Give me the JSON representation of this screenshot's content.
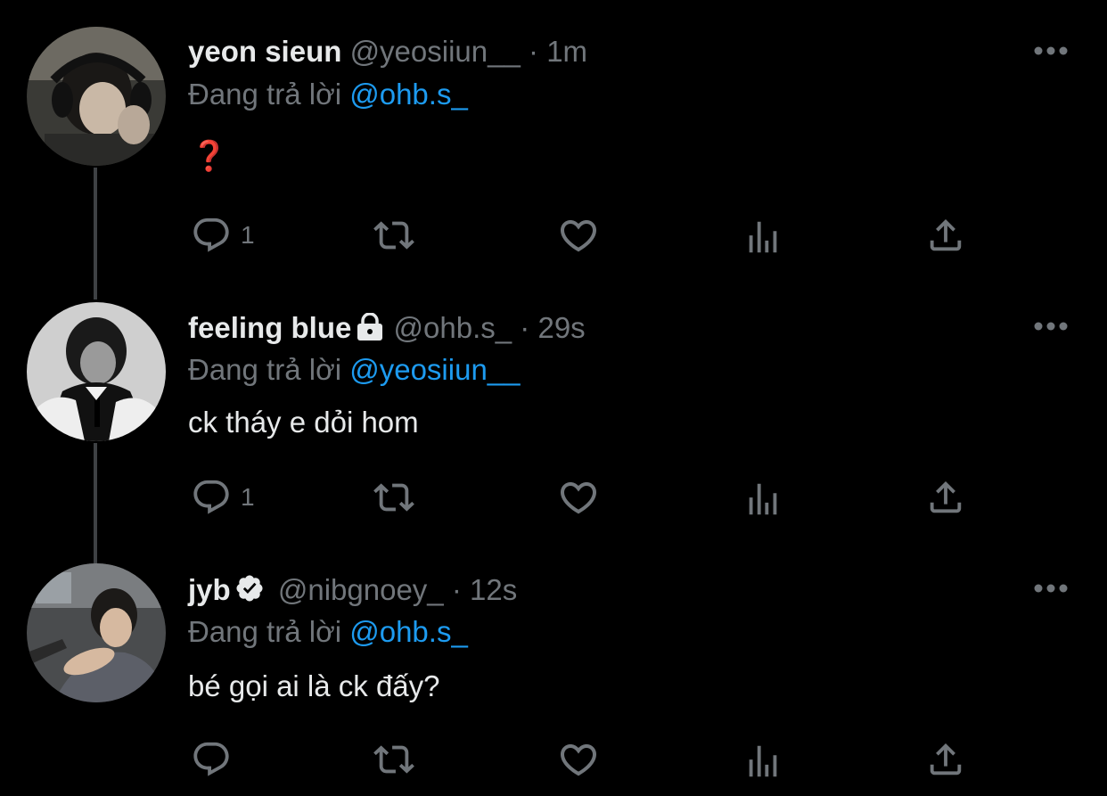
{
  "reply_prefix": "Đang trả lời",
  "tweets": [
    {
      "name": "yeon sieun",
      "handle": "@yeosiiun__",
      "dot": "·",
      "time": "1m",
      "reply_to": "@ohb.s_",
      "text": "❓",
      "reply_count": "1"
    },
    {
      "name": "feeling blue",
      "handle": "@ohb.s_",
      "dot": "·",
      "time": "29s",
      "reply_to": "@yeosiiun__",
      "text": "ck tháy e dỏi hom",
      "reply_count": "1"
    },
    {
      "name": "jyb",
      "handle": "@nibgnoey_",
      "dot": "·",
      "time": "12s",
      "reply_to": "@ohb.s_",
      "text": "bé gọi ai là ck đấy?",
      "reply_count": ""
    }
  ],
  "icons": {
    "reply": "reply-icon",
    "retweet": "retweet-icon",
    "like": "heart-icon",
    "views": "views-icon",
    "share": "share-icon",
    "more": "more-icon",
    "lock": "lock-icon",
    "verified": "verified-icon"
  },
  "colors": {
    "background": "#000000",
    "name": "#e7e9ea",
    "secondary": "#71767b",
    "mention": "#1d9bf0",
    "emoji_red": "#e0161a"
  }
}
